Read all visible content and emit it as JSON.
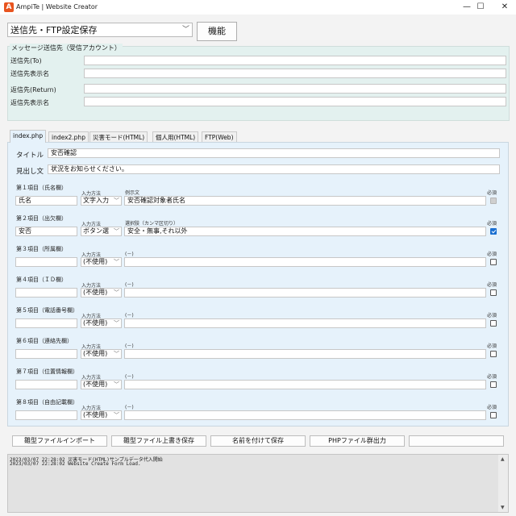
{
  "window": {
    "title": "AmpiTe | Website Creator",
    "app_icon": "A",
    "minimize": "—",
    "maximize": "☐",
    "close": "✕"
  },
  "toolbar": {
    "target_value": "送信先・FTP設定保存",
    "function_button": "機能"
  },
  "message_group": {
    "legend": "メッセージ送信先（受信アカウント）",
    "to_label": "送信先(To)",
    "to_value": "",
    "to_name_label": "送信先表示名",
    "to_name_value": "",
    "return_label": "返信先(Return)",
    "return_value": "",
    "return_name_label": "返信先表示名",
    "return_name_value": ""
  },
  "tabs": [
    "index.php",
    "index2.php",
    "災害モード(HTML)",
    "個人用(HTML)",
    "FTP(Web)"
  ],
  "form": {
    "title_label": "タイトル",
    "title_value": "安否確認",
    "heading_label": "見出し文",
    "heading_value": "状況をお知らせください。",
    "input_method_label": "入力方法",
    "required_label": "必須",
    "items": [
      {
        "label": "第１項目（氏名欄）",
        "name": "氏名",
        "method": "文字入力",
        "hint_label": "例示文",
        "hint_value": "安否確認対象者氏名",
        "state": "disabled"
      },
      {
        "label": "第２項目（出欠欄）",
        "name": "安否",
        "method": "ボタン選",
        "hint_label": "選択肢（カンマ区切り）",
        "hint_value": "安全・無事,それ以外",
        "state": "checked"
      },
      {
        "label": "第３項目（所属欄）",
        "name": "",
        "method": "(不使用)",
        "hint_label": "(－)",
        "hint_value": "",
        "state": "unchecked"
      },
      {
        "label": "第４項目（ＩＤ欄）",
        "name": "",
        "method": "(不使用)",
        "hint_label": "(－)",
        "hint_value": "",
        "state": "unchecked"
      },
      {
        "label": "第５項目（電話番号欄）",
        "name": "",
        "method": "(不使用)",
        "hint_label": "(－)",
        "hint_value": "",
        "state": "unchecked"
      },
      {
        "label": "第６項目（連絡先欄）",
        "name": "",
        "method": "(不使用)",
        "hint_label": "(－)",
        "hint_value": "",
        "state": "unchecked"
      },
      {
        "label": "第７項目（位置情報欄）",
        "name": "",
        "method": "(不使用)",
        "hint_label": "(－)",
        "hint_value": "",
        "state": "unchecked"
      },
      {
        "label": "第８項目（自由記載欄）",
        "name": "",
        "method": "(不使用)",
        "hint_label": "(－)",
        "hint_value": "",
        "state": "unchecked"
      }
    ]
  },
  "actions": {
    "import": "雛型ファイルインポート",
    "overwrite": "雛型ファイル上書き保存",
    "save_as": "名前を付けて保存",
    "export_php": "PHPファイル群出力",
    "extra": ""
  },
  "log": [
    "2023/03/07 22:28:02 災害モード(HTML)サンプルデータ代入開始",
    "2023/03/07 22:28:02 Website Create Form Load."
  ]
}
